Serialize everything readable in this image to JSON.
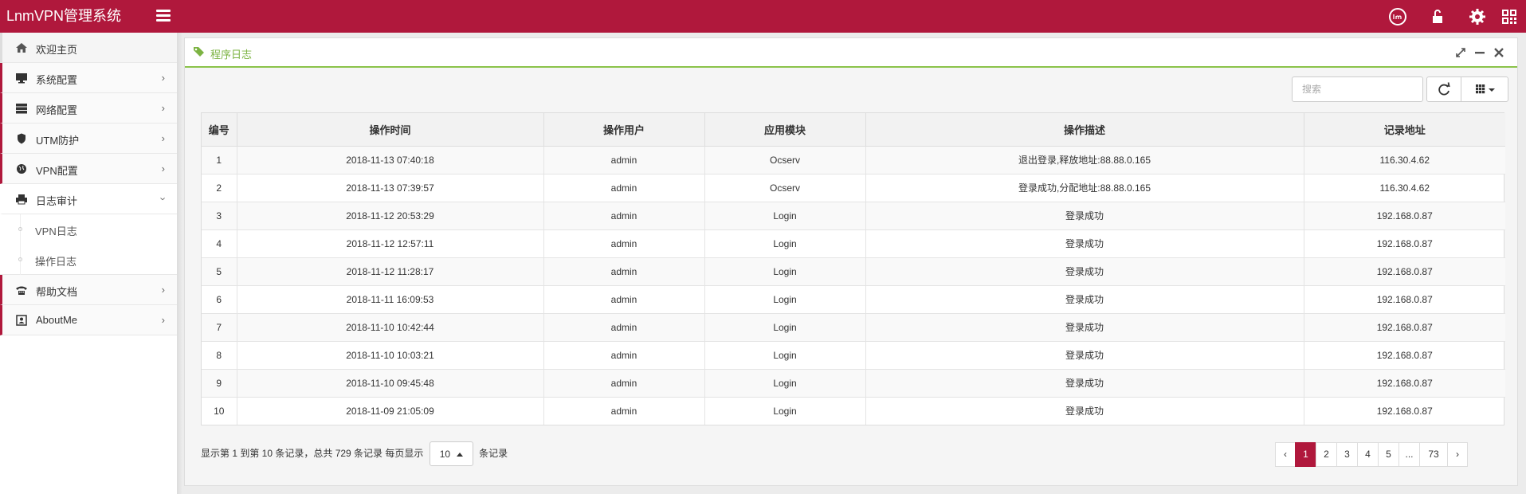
{
  "app": {
    "title": "LnmVPN管理系统"
  },
  "top_icons": [
    "lnm-logo-icon",
    "unlock-icon",
    "gear-icon",
    "qrcode-icon"
  ],
  "colors": {
    "brand": "#b0183c",
    "accent_green": "#7cb342"
  },
  "sidebar": {
    "items": [
      {
        "label": "欢迎主页",
        "icon": "home-icon"
      },
      {
        "label": "系统配置",
        "icon": "desktop-icon"
      },
      {
        "label": "网络配置",
        "icon": "server-icon"
      },
      {
        "label": "UTM防护",
        "icon": "shield-icon"
      },
      {
        "label": "VPN配置",
        "icon": "globe-icon"
      },
      {
        "label": "日志审计",
        "icon": "print-icon"
      },
      {
        "label": "帮助文档",
        "icon": "phone-icon"
      },
      {
        "label": "AboutMe",
        "icon": "contact-icon"
      }
    ],
    "subitems": [
      {
        "label": "VPN日志"
      },
      {
        "label": "操作日志"
      }
    ]
  },
  "panel": {
    "title": "程序日志",
    "search_placeholder": "搜索"
  },
  "table": {
    "columns": [
      "编号",
      "操作时间",
      "操作用户",
      "应用模块",
      "操作描述",
      "记录地址"
    ],
    "rows": [
      [
        "1",
        "2018-11-13 07:40:18",
        "admin",
        "Ocserv",
        "退出登录,释放地址:88.88.0.165",
        "116.30.4.62"
      ],
      [
        "2",
        "2018-11-13 07:39:57",
        "admin",
        "Ocserv",
        "登录成功,分配地址:88.88.0.165",
        "116.30.4.62"
      ],
      [
        "3",
        "2018-11-12 20:53:29",
        "admin",
        "Login",
        "登录成功",
        "192.168.0.87"
      ],
      [
        "4",
        "2018-11-12 12:57:11",
        "admin",
        "Login",
        "登录成功",
        "192.168.0.87"
      ],
      [
        "5",
        "2018-11-12 11:28:17",
        "admin",
        "Login",
        "登录成功",
        "192.168.0.87"
      ],
      [
        "6",
        "2018-11-11 16:09:53",
        "admin",
        "Login",
        "登录成功",
        "192.168.0.87"
      ],
      [
        "7",
        "2018-11-10 10:42:44",
        "admin",
        "Login",
        "登录成功",
        "192.168.0.87"
      ],
      [
        "8",
        "2018-11-10 10:03:21",
        "admin",
        "Login",
        "登录成功",
        "192.168.0.87"
      ],
      [
        "9",
        "2018-11-10 09:45:48",
        "admin",
        "Login",
        "登录成功",
        "192.168.0.87"
      ],
      [
        "10",
        "2018-11-09 21:05:09",
        "admin",
        "Login",
        "登录成功",
        "192.168.0.87"
      ]
    ]
  },
  "pager": {
    "info_prefix": "显示第 1 到第 10 条记录，总共 729 条记录 每页显示",
    "page_size": "10",
    "info_suffix": "条记录",
    "pages": [
      "‹",
      "1",
      "2",
      "3",
      "4",
      "5",
      "...",
      "73",
      "›"
    ],
    "active_page": "1"
  }
}
